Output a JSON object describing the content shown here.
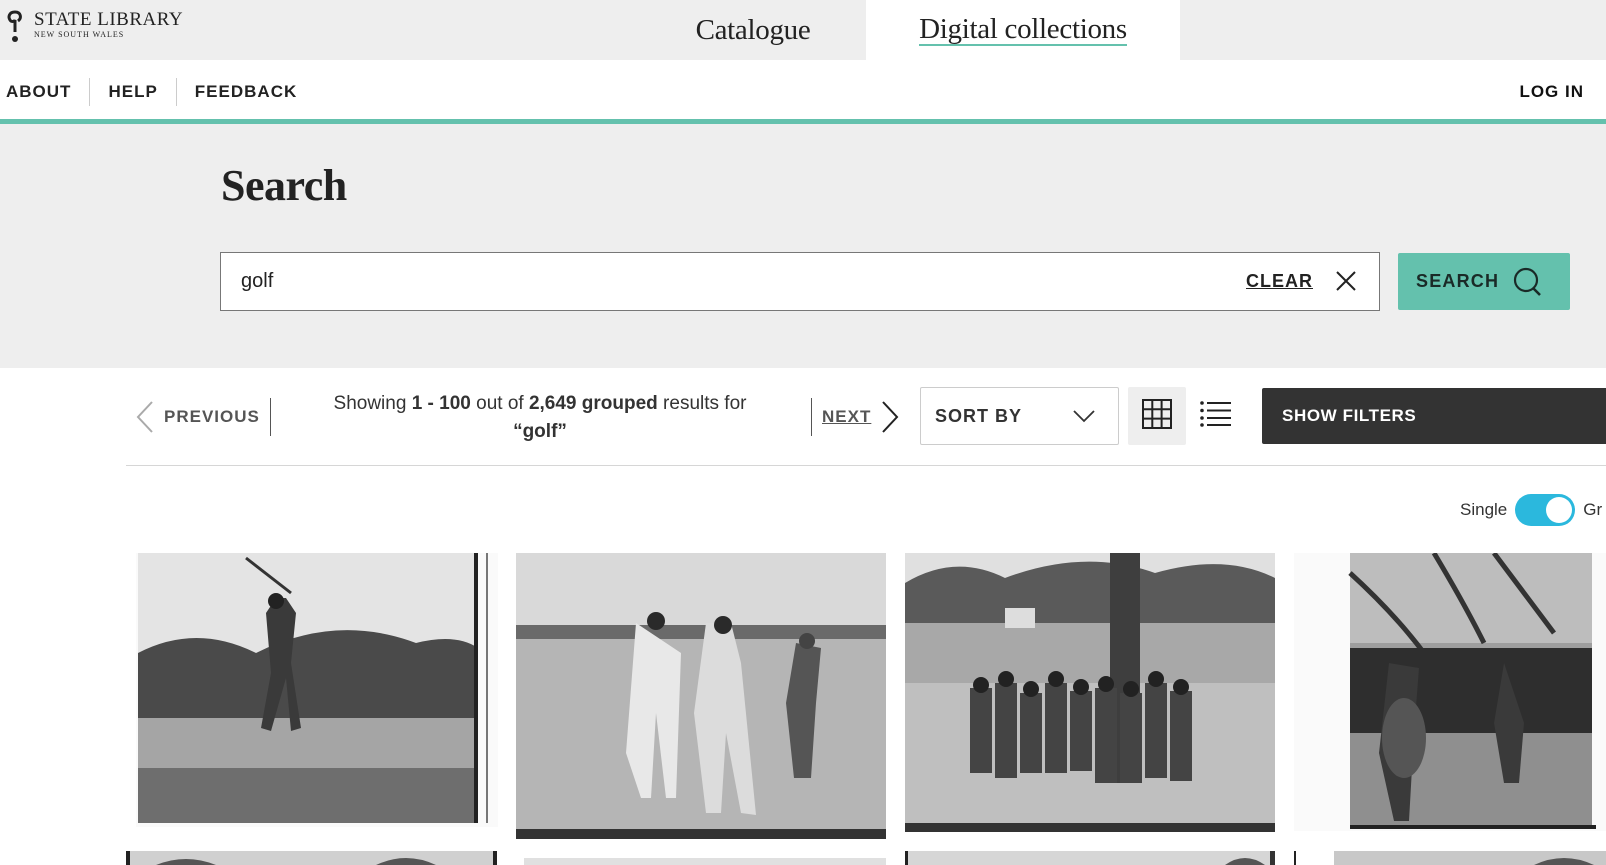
{
  "header": {
    "logo": {
      "title": "STATE LIBRARY",
      "subtitle": "NEW SOUTH WALES"
    },
    "portal_tabs": [
      {
        "label": "Catalogue",
        "active": false
      },
      {
        "label": "Digital collections",
        "active": true
      }
    ]
  },
  "nav": {
    "links": [
      "ABOUT",
      "HELP",
      "FEEDBACK"
    ],
    "login_label": "LOG IN"
  },
  "colors": {
    "accent": "#64c1ad",
    "toggle": "#2bb8dd",
    "dark_button": "#333333",
    "panel_bg": "#eeeeee"
  },
  "search": {
    "title": "Search",
    "query": "golf",
    "clear_label": "CLEAR",
    "button_label": "SEARCH",
    "icons": {
      "clear": "close-icon",
      "search": "search-icon"
    }
  },
  "results": {
    "previous_label": "PREVIOUS",
    "next_label": "NEXT",
    "text_prefix": "Showing ",
    "range": "1 - 100",
    "text_mid": " out of ",
    "total": "2,649 grouped",
    "text_suffix": " results for",
    "query_quoted": "“golf”",
    "sort_label": "SORT BY",
    "view_modes": [
      {
        "name": "grid",
        "icon": "grid-icon",
        "active": true
      },
      {
        "name": "list",
        "icon": "list-icon",
        "active": false
      }
    ],
    "show_filters_label": "SHOW FILTERS",
    "toggle": {
      "left_label": "Single",
      "right_label": "Gr",
      "state": "on"
    }
  },
  "thumbnails": [
    {
      "alt": "Golfer mid-swing on tee",
      "row": 1,
      "col": 1
    },
    {
      "alt": "Men walking across golf course",
      "row": 1,
      "col": 2
    },
    {
      "alt": "Group of women golfers under tree",
      "row": 1,
      "col": 3
    },
    {
      "alt": "Golfer and caddie with crowd",
      "row": 1,
      "col": 4
    },
    {
      "alt": "Golf course landscape",
      "row": 2,
      "col": 1
    },
    {
      "alt": "Golf scene",
      "row": 2,
      "col": 2
    },
    {
      "alt": "Golf course with trees",
      "row": 2,
      "col": 3
    },
    {
      "alt": "Golf course with trees",
      "row": 2,
      "col": 4
    }
  ]
}
